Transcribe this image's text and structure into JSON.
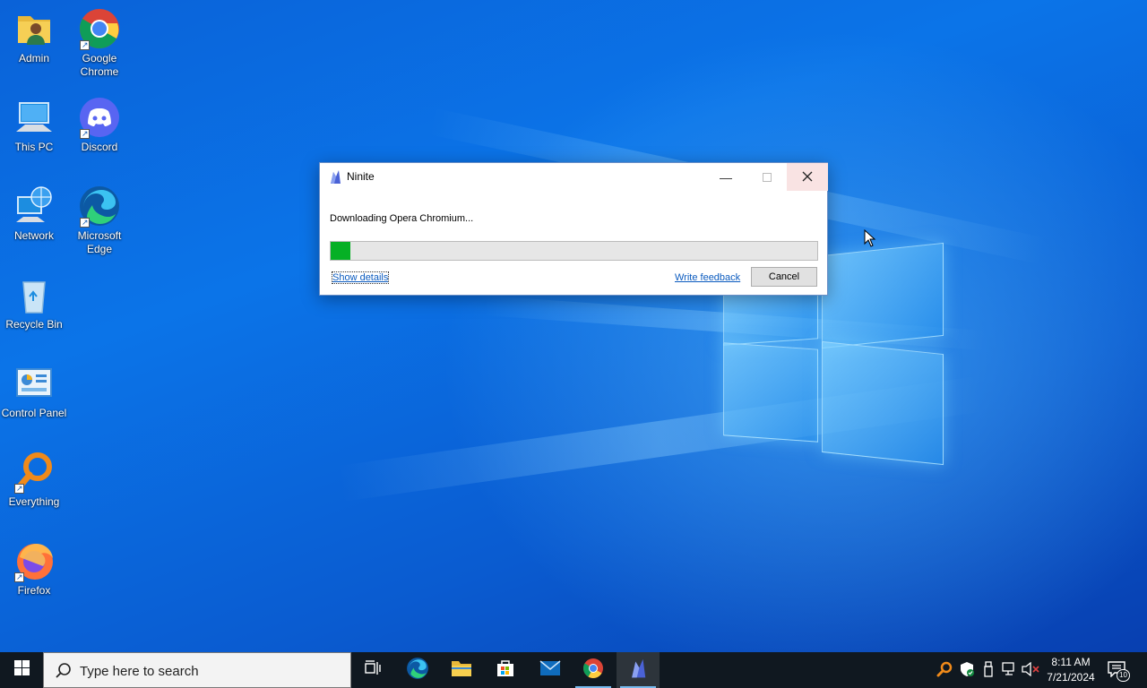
{
  "desktop": {
    "icons": [
      {
        "label": "Admin",
        "icon": "user-folder-icon"
      },
      {
        "label": "Google Chrome",
        "icon": "chrome-icon"
      },
      {
        "label": "This PC",
        "icon": "computer-icon"
      },
      {
        "label": "Discord",
        "icon": "discord-icon"
      },
      {
        "label": "Network",
        "icon": "network-icon"
      },
      {
        "label": "Microsoft Edge",
        "icon": "edge-icon"
      },
      {
        "label": "Recycle Bin",
        "icon": "recycle-bin-icon"
      },
      {
        "label": "Control Panel",
        "icon": "control-panel-icon"
      },
      {
        "label": "Everything",
        "icon": "everything-search-icon"
      },
      {
        "label": "Firefox",
        "icon": "firefox-icon"
      }
    ]
  },
  "dialog": {
    "title": "Ninite",
    "status_text": "Downloading Opera Chromium...",
    "progress": 0.04,
    "show_details": "Show details",
    "write_feedback": "Write feedback",
    "cancel_label": "Cancel"
  },
  "taskbar": {
    "search_placeholder": "Type here to search",
    "apps": [
      "task-view-icon",
      "edge-icon",
      "file-explorer-icon",
      "microsoft-store-icon",
      "mail-icon",
      "chrome-icon",
      "ninite-icon"
    ],
    "time": "8:11 AM",
    "date": "7/21/2024",
    "notification_count": "10"
  },
  "colors": {
    "accent": "#0078d7",
    "progress_fill": "#06b025",
    "taskbar_bg": "#101820",
    "link": "#0b5bbf"
  }
}
